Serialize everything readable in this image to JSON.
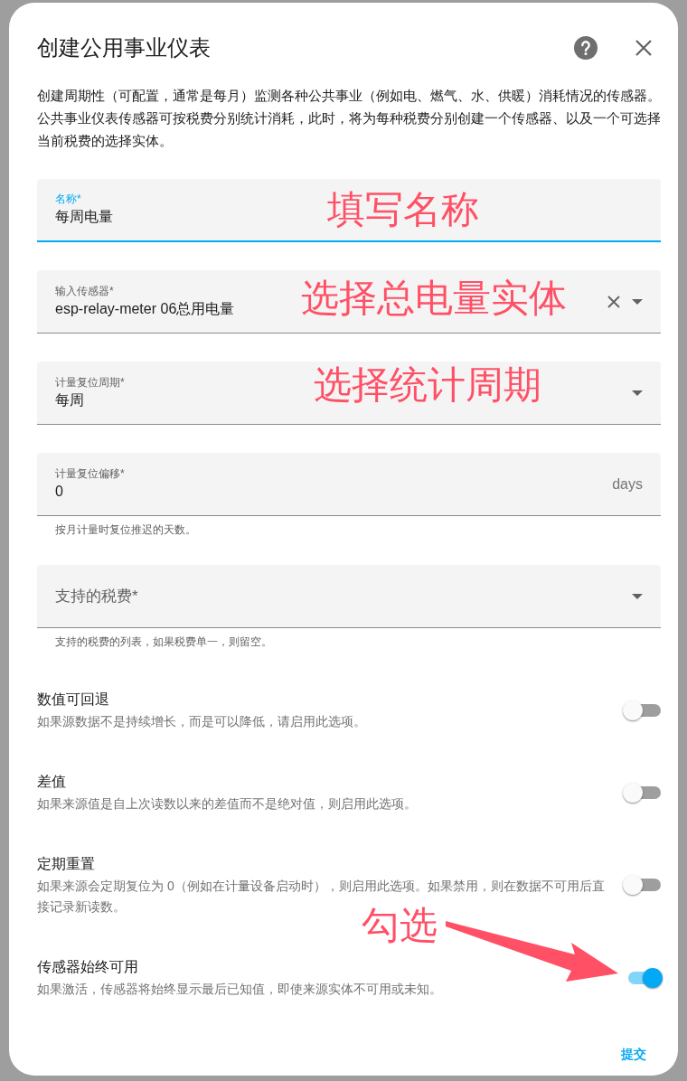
{
  "dialog": {
    "title": "创建公用事业仪表",
    "description": "创建周期性（可配置，通常是每月）监测各种公共事业（例如电、燃气、水、供暖）消耗情况的传感器。公共事业仪表传感器可按税费分别统计消耗，此时，将为每种税费分别创建一个传感器、以及一个可选择当前税费的选择实体。",
    "fields": [
      {
        "kind": "text",
        "label": "名称*",
        "value": "每周电量",
        "focused": true
      },
      {
        "kind": "select",
        "label": "输入传感器*",
        "value": "esp-relay-meter 06总用电量",
        "clearable": true,
        "focused": false
      },
      {
        "kind": "select",
        "label": "计量复位周期*",
        "value": "每周",
        "clearable": false,
        "focused": false
      },
      {
        "kind": "number",
        "label": "计量复位偏移*",
        "value": "0",
        "suffix": "days",
        "helper": "按月计量时复位推迟的天数。",
        "focused": false
      },
      {
        "kind": "select",
        "label": "支持的税费*",
        "clearable": false,
        "helper": "支持的税费的列表，如果税费单一，则留空。",
        "focused": false
      }
    ],
    "toggles": [
      {
        "title": "数值可回退",
        "description": "如果源数据不是持续增长，而是可以降低，请启用此选项。",
        "on": false
      },
      {
        "title": "差值",
        "description": "如果来源值是自上次读数以来的差值而不是绝对值，则启用此选项。",
        "on": false
      },
      {
        "title": "定期重置",
        "description": "如果来源会定期复位为 0（例如在计量设备启动时），则启用此选项。如果禁用，则在数据不可用后直接记录新读数。",
        "on": false
      },
      {
        "title": "传感器始终可用",
        "description": "如果激活，传感器将始终显示最后已知值，即使来源实体不可用或未知。",
        "on": true
      }
    ],
    "submit": "提交"
  },
  "annotations": [
    {
      "text": "填写名称"
    },
    {
      "text": "选择总电量实体"
    },
    {
      "text": "选择统计周期"
    },
    {
      "text": "勾选"
    }
  ]
}
